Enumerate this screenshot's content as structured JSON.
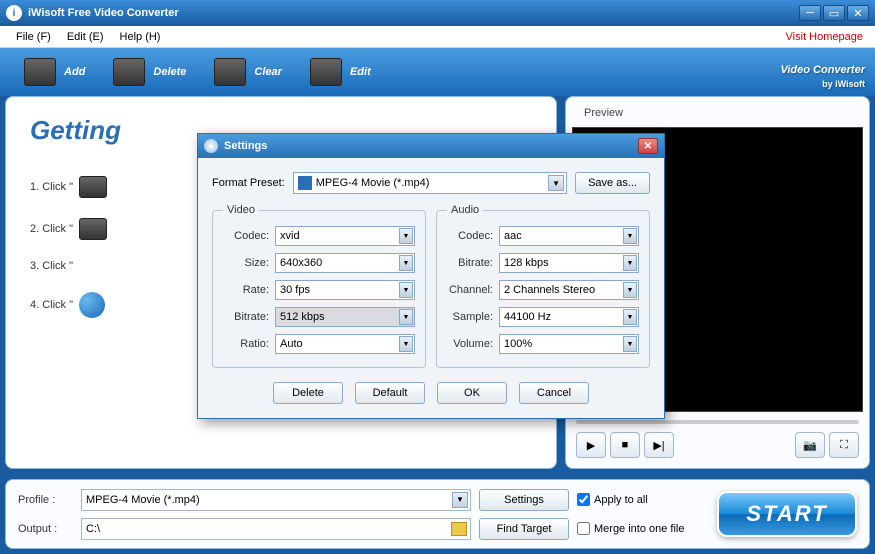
{
  "titlebar": {
    "app_name": "iWisoft Free Video Converter"
  },
  "menubar": {
    "items": [
      "File (F)",
      "Edit (E)",
      "Help (H)"
    ],
    "homepage": "Visit Homepage"
  },
  "toolbar": {
    "add": "Add",
    "delete": "Delete",
    "clear": "Clear",
    "edit": "Edit",
    "brand": "Video Converter",
    "brand_sub": "by iWisoft"
  },
  "getting": {
    "heading": "Getting",
    "steps": [
      "1. Click \"",
      "2. Click \"",
      "3. Click \"",
      "4. Click \""
    ]
  },
  "preview": {
    "tab": "Preview"
  },
  "bottom": {
    "profile_lbl": "Profile :",
    "profile_val": "MPEG-4 Movie (*.mp4)",
    "output_lbl": "Output :",
    "output_val": "C:\\",
    "settings": "Settings",
    "findtarget": "Find Target",
    "apply": "Apply to all",
    "merge": "Merge into one file",
    "start": "START"
  },
  "dialog": {
    "title": "Settings",
    "preset_lbl": "Format Preset:",
    "preset_val": "MPEG-4 Movie (*.mp4)",
    "saveas": "Save as...",
    "video": {
      "legend": "Video",
      "codec_lbl": "Codec:",
      "codec": "xvid",
      "size_lbl": "Size:",
      "size": "640x360",
      "rate_lbl": "Rate:",
      "rate": "30 fps",
      "bitrate_lbl": "Bitrate:",
      "bitrate": "512 kbps",
      "ratio_lbl": "Ratio:",
      "ratio": "Auto"
    },
    "audio": {
      "legend": "Audio",
      "codec_lbl": "Codec:",
      "codec": "aac",
      "bitrate_lbl": "Bitrate:",
      "bitrate": "128 kbps",
      "channel_lbl": "Channel:",
      "channel": "2 Channels Stereo",
      "sample_lbl": "Sample:",
      "sample": "44100 Hz",
      "volume_lbl": "Volume:",
      "volume": "100%"
    },
    "btns": {
      "delete": "Delete",
      "default": "Default",
      "ok": "OK",
      "cancel": "Cancel"
    }
  }
}
